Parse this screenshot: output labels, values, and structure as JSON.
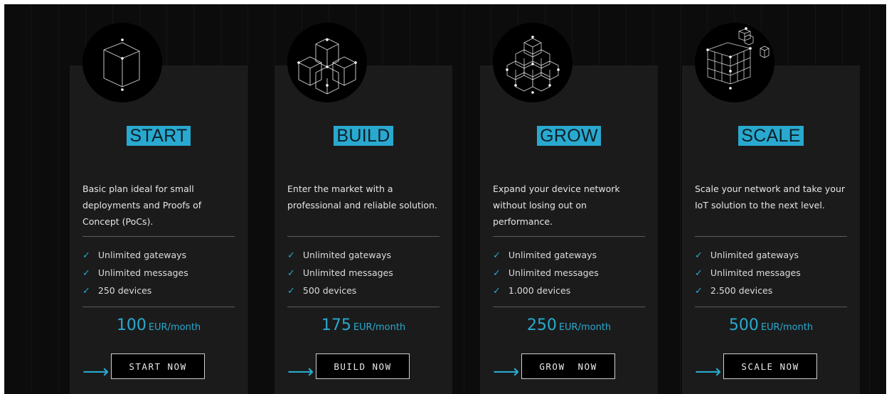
{
  "colors": {
    "accent": "#29a9cf",
    "card": "#1b1b1b",
    "background": "#0c0c0c"
  },
  "plans": [
    {
      "icon": "single-cube-icon",
      "title": "START",
      "description": "Basic plan ideal for small deployments and Proofs of Concept (PoCs).",
      "features": [
        "Unlimited gateways",
        "Unlimited messages",
        "250 devices"
      ],
      "price": "100",
      "unit": "EUR/month",
      "cta": "START NOW"
    },
    {
      "icon": "cube-stack-icon",
      "title": "BUILD",
      "description": "Enter the market with a professional and reliable solution.",
      "features": [
        "Unlimited gateways",
        "Unlimited messages",
        "500 devices"
      ],
      "price": "175",
      "unit": "EUR/month",
      "cta": "BUILD NOW"
    },
    {
      "icon": "cube-pyramid-icon",
      "title": "GROW",
      "description": "Expand your device network without losing out on performance.",
      "features": [
        "Unlimited gateways",
        "Unlimited messages",
        "1.000 devices"
      ],
      "price": "250",
      "unit": "EUR/month",
      "cta": "GROW  NOW"
    },
    {
      "icon": "cube-grid-icon",
      "title": "SCALE",
      "description": "Scale your network and take your IoT solution to the next level.",
      "features": [
        "Unlimited gateways",
        "Unlimited messages",
        "2.500 devices"
      ],
      "price": "500",
      "unit": "EUR/month",
      "cta": "SCALE NOW"
    }
  ]
}
